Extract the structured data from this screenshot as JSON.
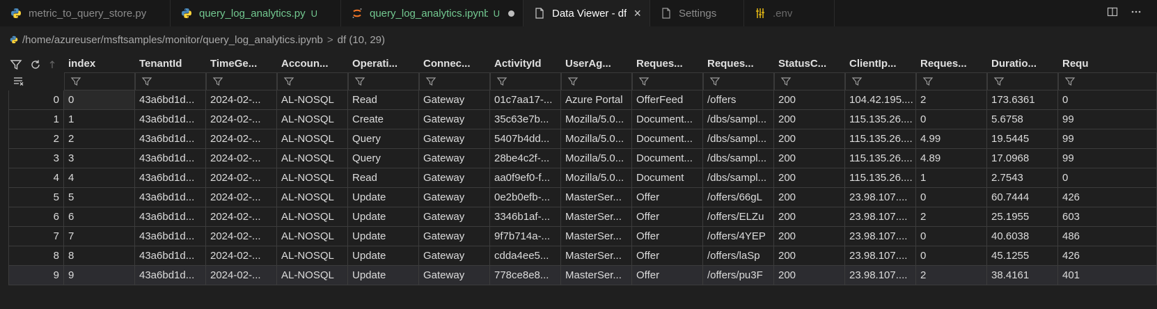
{
  "tabs": [
    {
      "label": "metric_to_query_store.py",
      "icon": "python-icon",
      "status": "",
      "modified": false,
      "active": false
    },
    {
      "label": "query_log_analytics.py",
      "icon": "python-icon",
      "status": "U",
      "modified": false,
      "active": false
    },
    {
      "label": "query_log_analytics.ipynb",
      "icon": "jupyter-icon",
      "status": "U",
      "modified": true,
      "active": false
    },
    {
      "label": "Data Viewer - df",
      "icon": "file-icon",
      "status": "",
      "modified": false,
      "active": true,
      "close": "×"
    },
    {
      "label": "Settings",
      "icon": "file-icon",
      "status": "",
      "modified": false,
      "active": false
    },
    {
      "label": ".env",
      "icon": "env-icon",
      "status": "",
      "modified": false,
      "active": false
    }
  ],
  "breadcrumb": {
    "path": "/home/azureuser/msftsamples/monitor/query_log_analytics.ipynb",
    "separator": ">",
    "item": "df (10, 29)"
  },
  "grid": {
    "columns": [
      "index",
      "TenantId",
      "TimeGe...",
      "Accoun...",
      "Operati...",
      "Connec...",
      "ActivityId",
      "UserAg...",
      "Reques...",
      "Reques...",
      "StatusC...",
      "ClientIp...",
      "Reques...",
      "Duratio...",
      "Requ"
    ],
    "rows": [
      {
        "n": "0",
        "cells": [
          "0",
          "43a6bd1d...",
          "2024-02-...",
          "AL-NOSQL",
          "Read",
          "Gateway",
          "01c7aa17-...",
          "Azure Portal",
          "OfferFeed",
          "/offers",
          "200",
          "104.42.195....",
          "2",
          "173.6361",
          "0"
        ]
      },
      {
        "n": "1",
        "cells": [
          "1",
          "43a6bd1d...",
          "2024-02-...",
          "AL-NOSQL",
          "Create",
          "Gateway",
          "35c63e7b...",
          "Mozilla/5.0...",
          "Document...",
          "/dbs/sampl...",
          "200",
          "115.135.26....",
          "0",
          "5.6758",
          "99"
        ]
      },
      {
        "n": "2",
        "cells": [
          "2",
          "43a6bd1d...",
          "2024-02-...",
          "AL-NOSQL",
          "Query",
          "Gateway",
          "5407b4dd...",
          "Mozilla/5.0...",
          "Document...",
          "/dbs/sampl...",
          "200",
          "115.135.26....",
          "4.99",
          "19.5445",
          "99"
        ]
      },
      {
        "n": "3",
        "cells": [
          "3",
          "43a6bd1d...",
          "2024-02-...",
          "AL-NOSQL",
          "Query",
          "Gateway",
          "28be4c2f-...",
          "Mozilla/5.0...",
          "Document...",
          "/dbs/sampl...",
          "200",
          "115.135.26....",
          "4.89",
          "17.0968",
          "99"
        ]
      },
      {
        "n": "4",
        "cells": [
          "4",
          "43a6bd1d...",
          "2024-02-...",
          "AL-NOSQL",
          "Read",
          "Gateway",
          "aa0f9ef0-f...",
          "Mozilla/5.0...",
          "Document",
          "/dbs/sampl...",
          "200",
          "115.135.26....",
          "1",
          "2.7543",
          "0"
        ]
      },
      {
        "n": "5",
        "cells": [
          "5",
          "43a6bd1d...",
          "2024-02-...",
          "AL-NOSQL",
          "Update",
          "Gateway",
          "0e2b0efb-...",
          "MasterSer...",
          "Offer",
          "/offers/66gL",
          "200",
          "23.98.107....",
          "0",
          "60.7444",
          "426"
        ]
      },
      {
        "n": "6",
        "cells": [
          "6",
          "43a6bd1d...",
          "2024-02-...",
          "AL-NOSQL",
          "Update",
          "Gateway",
          "3346b1af-...",
          "MasterSer...",
          "Offer",
          "/offers/ELZu",
          "200",
          "23.98.107....",
          "2",
          "25.1955",
          "603"
        ]
      },
      {
        "n": "7",
        "cells": [
          "7",
          "43a6bd1d...",
          "2024-02-...",
          "AL-NOSQL",
          "Update",
          "Gateway",
          "9f7b714a-...",
          "MasterSer...",
          "Offer",
          "/offers/4YEP",
          "200",
          "23.98.107....",
          "0",
          "40.6038",
          "486"
        ]
      },
      {
        "n": "8",
        "cells": [
          "8",
          "43a6bd1d...",
          "2024-02-...",
          "AL-NOSQL",
          "Update",
          "Gateway",
          "cdda4ee5...",
          "MasterSer...",
          "Offer",
          "/offers/laSp",
          "200",
          "23.98.107....",
          "0",
          "45.1255",
          "426"
        ]
      },
      {
        "n": "9",
        "cells": [
          "9",
          "43a6bd1d...",
          "2024-02-...",
          "AL-NOSQL",
          "Update",
          "Gateway",
          "778ce8e8...",
          "MasterSer...",
          "Offer",
          "/offers/pu3F",
          "200",
          "23.98.107....",
          "2",
          "38.4161",
          "401"
        ]
      }
    ]
  },
  "colors": {
    "accent": "#73c991",
    "python": "#3572A5",
    "jupyter": "#f37626",
    "env": "#e2b714"
  }
}
